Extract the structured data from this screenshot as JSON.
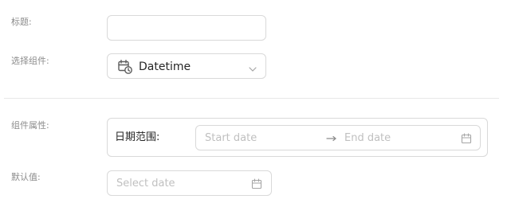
{
  "form": {
    "title_label": "标题:",
    "title_value": "",
    "component_label": "选择组件:",
    "component_selected": "Datetime",
    "component_icon": "calendar-clock-icon",
    "props_label": "组件属性:",
    "date_range_label": "日期范围:",
    "start_placeholder": "Start date",
    "end_placeholder": "End date",
    "default_label": "默认值:",
    "select_date_placeholder": "Select date"
  },
  "colors": {
    "border": "#d9d9d9",
    "label": "#8c8c8c",
    "placeholder": "#c0c0c0",
    "text": "#262626"
  }
}
